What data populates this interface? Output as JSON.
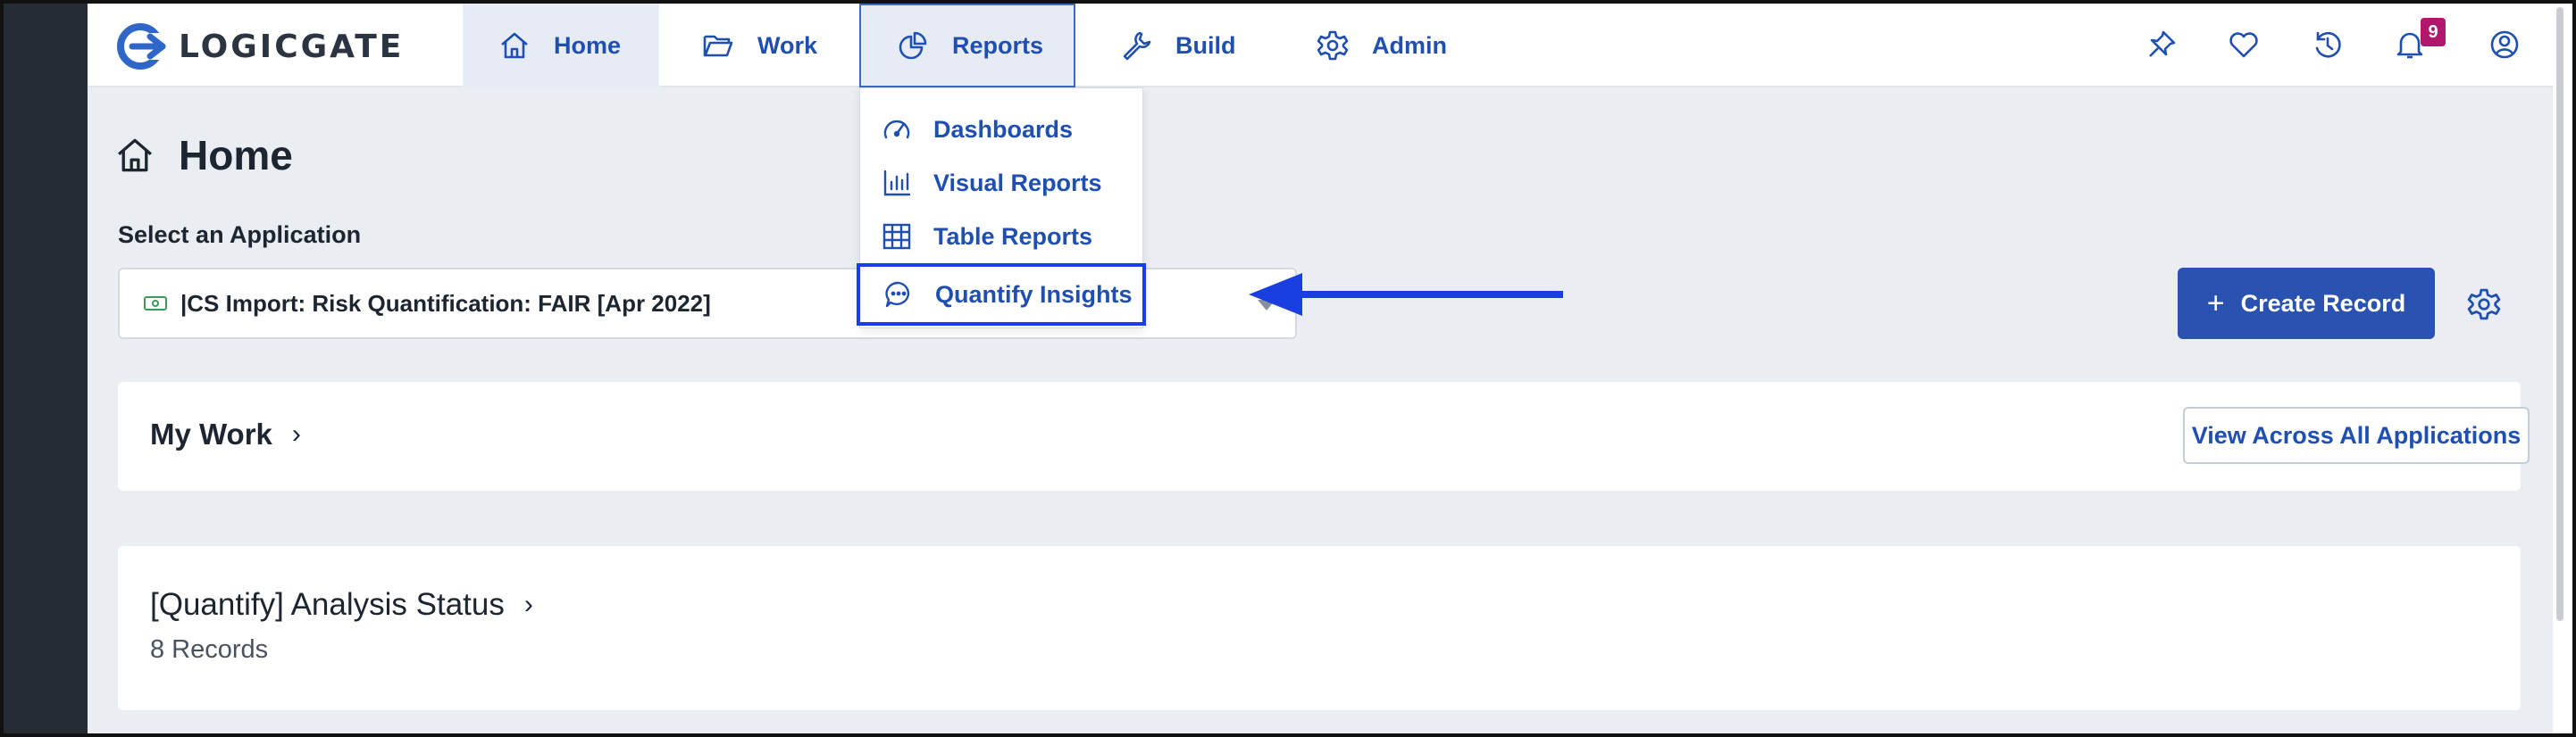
{
  "nav": {
    "logo_text": "LOGICGATE",
    "items": [
      {
        "label": "Home",
        "icon": "home-icon"
      },
      {
        "label": "Work",
        "icon": "folder-icon"
      },
      {
        "label": "Reports",
        "icon": "pie-chart-icon"
      },
      {
        "label": "Build",
        "icon": "wrench-icon"
      },
      {
        "label": "Admin",
        "icon": "gear-icon"
      }
    ],
    "right_icons": [
      "pin-icon",
      "heart-icon",
      "history-icon",
      "bell-icon",
      "user-circle-icon"
    ],
    "notification_count": "9"
  },
  "reports_menu": {
    "items": [
      {
        "label": "Dashboards",
        "icon": "gauge-icon"
      },
      {
        "label": "Visual Reports",
        "icon": "bar-chart-icon"
      },
      {
        "label": "Table Reports",
        "icon": "table-icon"
      },
      {
        "label": "Quantify Insights",
        "icon": "chat-insights-icon"
      }
    ],
    "highlighted": "Quantify Insights"
  },
  "page": {
    "title": "Home",
    "application_label": "Select an Application",
    "application_value": "|CS Import: Risk Quantification: FAIR [Apr 2022]",
    "create_record": "Create Record"
  },
  "cards": {
    "my_work": {
      "title": "My Work",
      "action": "View Across All Applications"
    },
    "quantify": {
      "title": "[Quantify] Analysis Status",
      "count": "8 Records"
    }
  },
  "colors": {
    "accent": "#1f4fb0",
    "primary_button": "#2a52b0",
    "annotation": "#1a3fe0",
    "badge": "#b1186b",
    "page_bg": "#eaedf1"
  }
}
